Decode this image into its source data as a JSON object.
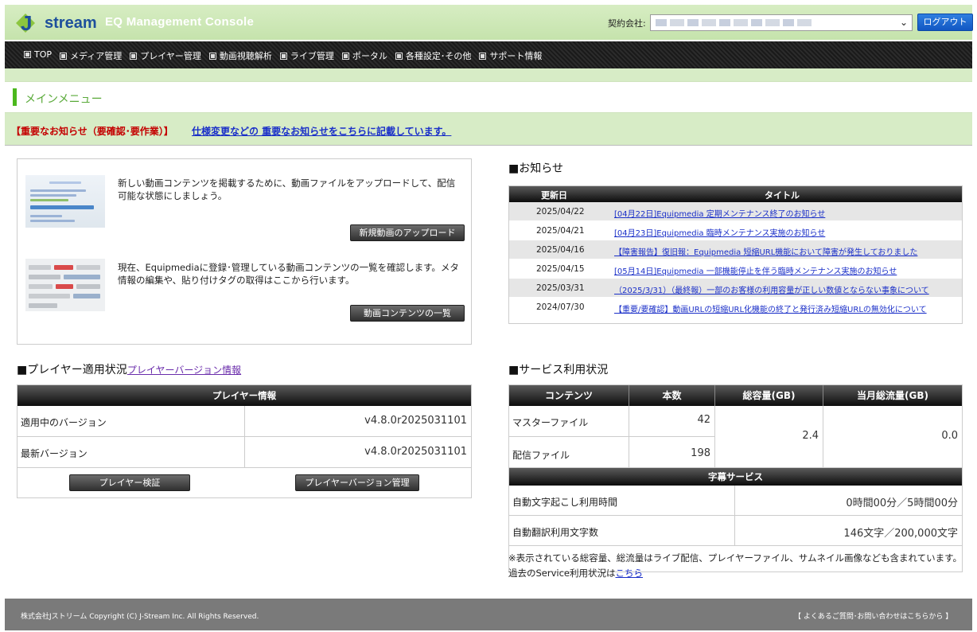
{
  "header": {
    "logo_text": "stream",
    "console_title": "EQ Management Console",
    "company_label": "契約会社:",
    "logout_label": "ログアウト",
    "colors": {
      "header_bg": "#c5e3ac",
      "logout_bg": "#1a66d4",
      "logo_blue": "#1d4f9c"
    }
  },
  "nav": {
    "items": [
      "TOP",
      "メディア管理",
      "プレイヤー管理",
      "動画視聴解析",
      "ライブ管理",
      "ポータル",
      "各種設定･その他",
      "サポート情報"
    ]
  },
  "page": {
    "section_title": "メインメニュー",
    "notice_label": "【重要なお知らせ（要確認･要作業）】",
    "notice_link": "仕様変更などの 重要なお知らせをこちらに記載しています。"
  },
  "quick_menu": {
    "upload_text": "新しい動画コンテンツを掲載するために、動画ファイルをアップロードして、配信可能な状態にしましょう。",
    "upload_button": "新規動画のアップロード",
    "list_text": "現在、Equipmediaに登録･管理している動画コンテンツの一覧を確認します。メタ情報の編集や、貼り付けタグの取得はここから行います。",
    "list_button": "動画コンテンツの一覧"
  },
  "news": {
    "heading": "■お知らせ",
    "col_date": "更新日",
    "col_title": "タイトル",
    "rows": [
      {
        "date": "2025/04/22",
        "title": "[04月22日]Equipmedia 定期メンテナンス終了のお知らせ"
      },
      {
        "date": "2025/04/21",
        "title": "[04月23日]Equipmedia 臨時メンテナンス実施のお知らせ"
      },
      {
        "date": "2025/04/16",
        "title": "【障害報告】復旧報：Equipmedia 短縮URL機能において障害が発生しておりました"
      },
      {
        "date": "2025/04/15",
        "title": "[05月14日]Equipmedia 一部機能停止を伴う臨時メンテナンス実施のお知らせ"
      },
      {
        "date": "2025/03/31",
        "title": "（2025/3/31）（最終報）一部のお客様の利用容量が正しい数値とならない事象について"
      },
      {
        "date": "2024/07/30",
        "title": "【重要/要確認】動画URLの短縮URL化機能の終了と発行済み短縮URLの無効化について"
      }
    ]
  },
  "player": {
    "heading": "■プレイヤー適用状況",
    "version_info_link": "プレイヤーバージョン情報",
    "table_title": "プレイヤー情報",
    "current_label": "適用中のバージョン",
    "current_value": "v4.8.0r2025031101",
    "latest_label": "最新バージョン",
    "latest_value": "v4.8.0r2025031101",
    "verify_button": "プレイヤー検証",
    "version_button": "プレイヤーバージョン管理"
  },
  "service": {
    "heading": "■サービス利用状況",
    "col_contents": "コンテンツ",
    "col_count": "本数",
    "col_total": "総容量(GB)",
    "col_traffic": "当月総流量(GB)",
    "master_label": "マスターファイル",
    "master_count": "42",
    "delivery_label": "配信ファイル",
    "delivery_count": "198",
    "total_gb": "2.4",
    "traffic_gb": "0.0",
    "caption_title": "字幕サービス",
    "transcribe_label": "自動文字起こし利用時間",
    "transcribe_value": "0時間00分／5時間00分",
    "translate_label": "自動翻訳利用文字数",
    "translate_value": "146文字／200,000文字",
    "note": "※表示されている総容量、総流量はライブ配信、プレイヤーファイル、サムネイル画像なども含まれています。過去のService利用状況は",
    "note_link": "こちら"
  },
  "footer": {
    "copyright": "株式会社Jストリーム Copyright (C) J-Stream Inc. All Rights Reserved.",
    "faq": "【 よくあるご質問･お問い合わせはこちらから 】"
  }
}
